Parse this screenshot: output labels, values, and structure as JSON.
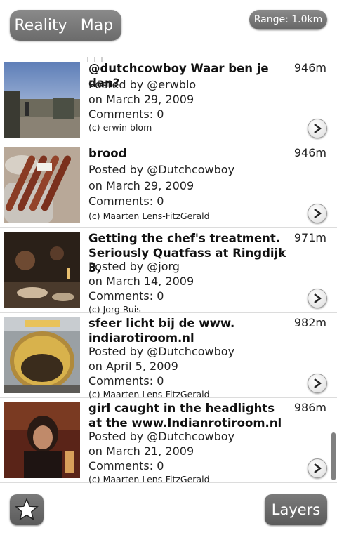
{
  "header": {
    "reality_label": "Reality",
    "map_label": "Map",
    "range_label": "Range: 1.0km"
  },
  "items": [
    {
      "title": "@dutchcowboy Waar ben je dan?",
      "distance": "946m",
      "posted_by": "Posted by @erwblo",
      "date": "on March 29, 2009",
      "comments": "Comments: 0",
      "credit": "(c) erwin blom"
    },
    {
      "title": "brood",
      "distance": "946m",
      "posted_by": "Posted by @Dutchcowboy",
      "date": "on March 29, 2009",
      "comments": "Comments: 0",
      "credit": "(c) Maarten Lens-FitzGerald"
    },
    {
      "title": "Getting the chef's treatment. Seriously Quatfass at Ringdijk 3,",
      "distance": "971m",
      "posted_by": "Posted by @jorg",
      "date": "on March 14, 2009",
      "comments": "Comments: 0",
      "credit": "(c) Jorg Ruis"
    },
    {
      "title": "sfeer licht bij de www. indiarotiroom.nl",
      "distance": "982m",
      "posted_by": "Posted by @Dutchcowboy",
      "date": "on April 5, 2009",
      "comments": "Comments: 0",
      "credit": "(c) Maarten Lens-FitzGerald"
    },
    {
      "title": "girl caught in the headlights at the www.Indianrotiroom.nl",
      "distance": "986m",
      "posted_by": "Posted by @Dutchcowboy",
      "date": "on March 21, 2009",
      "comments": "Comments: 0",
      "credit": "(c) Maarten Lens-FitzGerald"
    }
  ],
  "footer": {
    "layers_label": "Layers",
    "favorites_icon": "star-icon"
  }
}
